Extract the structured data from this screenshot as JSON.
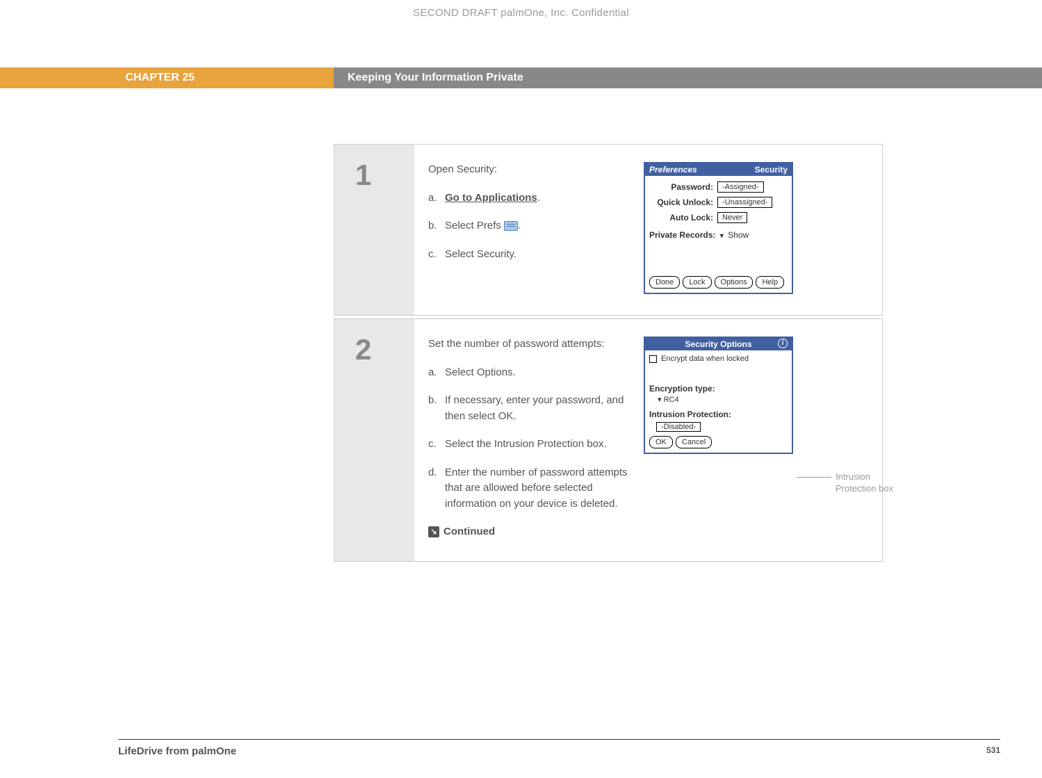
{
  "draftHeader": "SECOND DRAFT palmOne, Inc.  Confidential",
  "chapter": {
    "label": "CHAPTER 25",
    "title": "Keeping Your Information Private"
  },
  "step1": {
    "num": "1",
    "intro": "Open Security:",
    "a_marker": "a.",
    "a_link": "Go to Applications",
    "a_suffix": ".",
    "b_marker": "b.",
    "b_prefix": "Select Prefs ",
    "b_suffix": ".",
    "c_marker": "c.",
    "c_text": "Select Security."
  },
  "palm1": {
    "titleLeft": "Preferences",
    "titleRight": "Security",
    "passwordLabel": "Password:",
    "passwordVal": "-Assigned-",
    "quickLabel": "Quick Unlock:",
    "quickVal": "-Unassigned-",
    "autoLabel": "Auto Lock:",
    "autoVal": "Never",
    "privateLabel": "Private Records:",
    "privateArrow": "▾",
    "privateVal": "Show",
    "btnDone": "Done",
    "btnLock": "Lock",
    "btnOptions": "Options",
    "btnHelp": "Help"
  },
  "step2": {
    "num": "2",
    "intro": "Set the number of password attempts:",
    "a_marker": "a.",
    "a_text": "Select Options.",
    "b_marker": "b.",
    "b_text": "If necessary, enter your password, and then select OK.",
    "c_marker": "c.",
    "c_text": "Select the Intrusion Protection box.",
    "d_marker": "d.",
    "d_text": "Enter the number of password attempts that are allowed before selected information on your device is deleted.",
    "continued": "Continued"
  },
  "palm2": {
    "title": "Security Options",
    "info": "i",
    "encryptCheck": "Encrypt data when locked",
    "encTypeLabel": "Encryption type:",
    "encTypeArrow": "▾",
    "encTypeVal": "RC4",
    "intrusionLabel": "Intrusion Protection:",
    "intrusionVal": "-Disabled-",
    "btnOK": "OK",
    "btnCancel": "Cancel"
  },
  "callout": "Intrusion Protection box",
  "footer": {
    "left": "LifeDrive from palmOne",
    "right": "531"
  }
}
